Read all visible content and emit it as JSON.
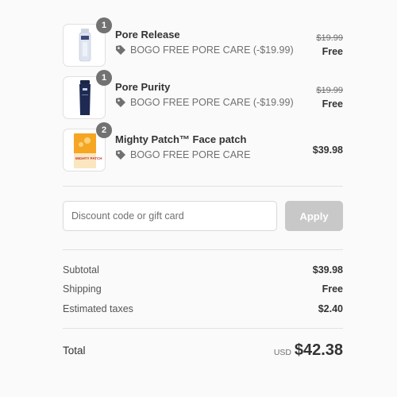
{
  "items": [
    {
      "name": "Pore Release",
      "quantity": "1",
      "discount_label": "BOGO FREE PORE CARE (-$19.99)",
      "original_price": "$19.99",
      "final_price": "Free",
      "image": "clear-serum-bottle"
    },
    {
      "name": "Pore Purity",
      "quantity": "1",
      "discount_label": "BOGO FREE PORE CARE (-$19.99)",
      "original_price": "$19.99",
      "final_price": "Free",
      "image": "navy-tube"
    },
    {
      "name": "Mighty Patch™ Face patch",
      "quantity": "2",
      "discount_label": "BOGO FREE PORE CARE",
      "original_price": "",
      "final_price": "$39.98",
      "image": "mighty-patch-box",
      "image_text": "MIGHTY PATCH"
    }
  ],
  "discount": {
    "placeholder": "Discount code or gift card",
    "apply_label": "Apply"
  },
  "totals": {
    "subtotal_label": "Subtotal",
    "subtotal_value": "$39.98",
    "shipping_label": "Shipping",
    "shipping_value": "Free",
    "taxes_label": "Estimated taxes",
    "taxes_value": "$2.40",
    "total_label": "Total",
    "currency": "USD",
    "total_value": "$42.38"
  },
  "colors": {
    "apply_disabled": "#c8c8c8",
    "badge": "#727272",
    "patch_orange": "#f5a623"
  }
}
